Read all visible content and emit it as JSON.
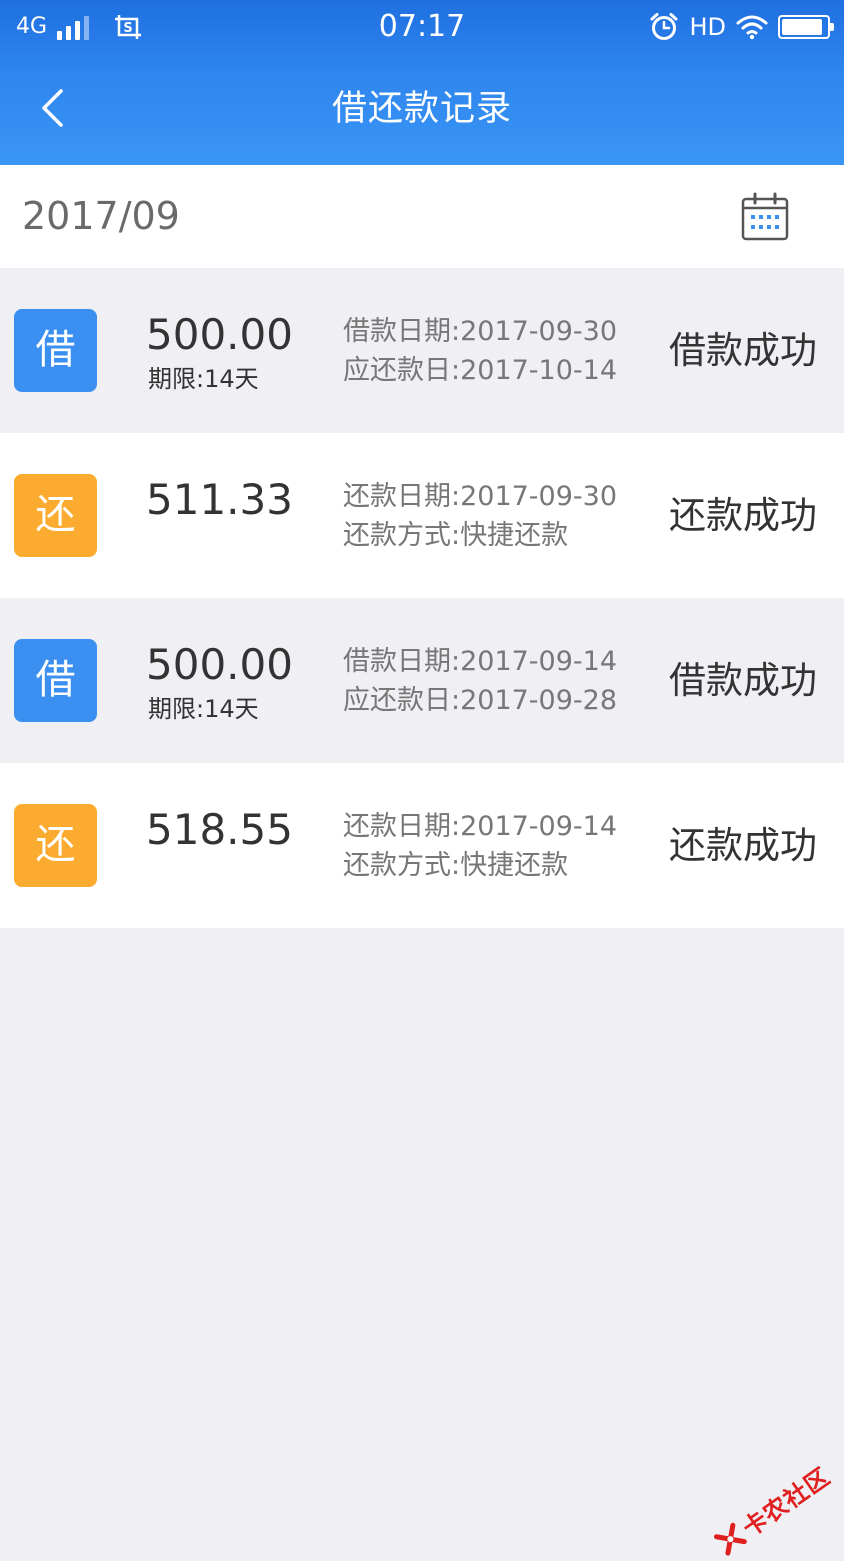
{
  "status_bar": {
    "network": "4G",
    "time": "07:17",
    "hd": "HD",
    "battery_level": 0.92,
    "icons": [
      "signal-icon",
      "screenshot-icon",
      "alarm-icon",
      "wifi-icon",
      "battery-icon"
    ]
  },
  "header": {
    "title": "借还款记录",
    "back_icon": "chevron-left-icon"
  },
  "month_bar": {
    "month": "2017/09",
    "calendar_icon": "calendar-icon"
  },
  "records": [
    {
      "kind": "borrow",
      "badge": "借",
      "amount": "500.00",
      "term": "期限:14天",
      "line1": "借款日期:2017-09-30",
      "line2": "应还款日:2017-10-14",
      "status": "借款成功"
    },
    {
      "kind": "repay",
      "badge": "还",
      "amount": "511.33",
      "term": "",
      "line1": "还款日期:2017-09-30",
      "line2": "还款方式:快捷还款",
      "status": "还款成功"
    },
    {
      "kind": "borrow",
      "badge": "借",
      "amount": "500.00",
      "term": "期限:14天",
      "line1": "借款日期:2017-09-14",
      "line2": "应还款日:2017-09-28",
      "status": "借款成功"
    },
    {
      "kind": "repay",
      "badge": "还",
      "amount": "518.55",
      "term": "",
      "line1": "还款日期:2017-09-14",
      "line2": "还款方式:快捷还款",
      "status": "还款成功"
    }
  ],
  "watermark": {
    "text": "卡农社区",
    "logo_icon": "kanong-logo-icon"
  },
  "colors": {
    "header_blue": "#2f86ee",
    "borrow_badge": "#3a8ff0",
    "repay_badge": "#fbac30",
    "row_shade": "#efeff4",
    "watermark_red": "#e02020"
  }
}
